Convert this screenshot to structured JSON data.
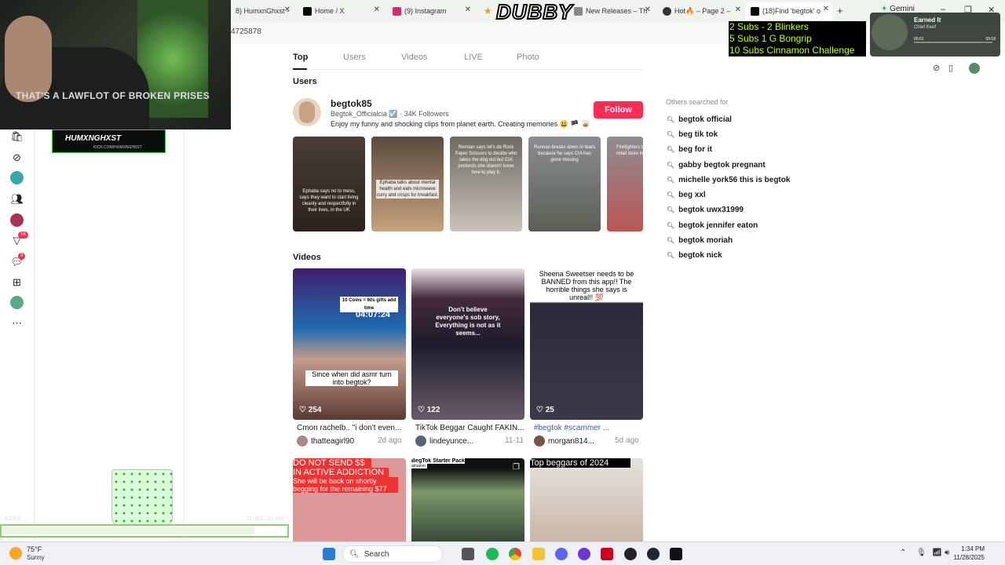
{
  "browser": {
    "tabs": [
      {
        "label": "8) HumxnGhxst -",
        "color": "#53fc18"
      },
      {
        "label": "Home / X",
        "color": "#000000"
      },
      {
        "label": "(9) Instagram",
        "color": "#d62976"
      },
      {
        "label": "New Releases – Th",
        "color": "#888888"
      },
      {
        "label": "Hot🔥 – Page 2 –",
        "color": "#333333"
      },
      {
        "label": "(18)Find 'begtok' o",
        "color": "#000000"
      }
    ],
    "new_tab": "+",
    "gemini": "Gemini",
    "address_fragment": "4725878"
  },
  "overlay": {
    "cam_text": "THAT'S A LAWFLOT OF BROKEN PRISES",
    "kick_name": "HUMXNGHXST",
    "kick_url": "KICK.COM/HUMXNGHXST",
    "dubby": "DUBBY",
    "subs_goals": [
      "2 Subs - 2 Blinkers",
      "5 Subs 1 G Bongrip",
      "10 Subs Cinnamon Challenge"
    ],
    "music_title": "Earned It",
    "music_artist": "Chief Keef",
    "music_elapsed": "00:01",
    "music_total": "09:18",
    "goal_left": "KICKS",
    "goal_right": "11,353 / 20,000"
  },
  "rail": {
    "badges": {
      "activity": "16",
      "messages": "9"
    }
  },
  "search_tabs": [
    "Top",
    "Users",
    "Videos",
    "LIVE",
    "Photo"
  ],
  "users_section": {
    "heading": "Users",
    "username": "begtok85",
    "handle": "Begtok_Officialcia ☑️ · 34K Followers",
    "bio": "Enjoy my funny and shocking clips from planet earth. Creating memories 😃 🏴 🥃",
    "follow_label": "Follow",
    "thumbs": [
      "Ephaba says no to mess, says they want to start living cleanly and respectfully in their lives, in the UK",
      "Ephaba talks about mental health and eats microwave curry and crisps for breakfast.",
      "Ronnan says let's do Rock Paper Scissors to decide who takes the dog out but CIA pretends she doesn't know how to play it.",
      "Ronnan breaks down in tears because he says CIA has gone missing",
      "Firefighters tackle a huge retail store in London, UK"
    ]
  },
  "videos_section": {
    "heading": "Videos",
    "items": [
      {
        "overlay": "Since when did asmr turn into begtok?",
        "likes": "254",
        "title": "Cmon rachelb.. \"i don't even...",
        "user": "thatteagirl90",
        "date": "2d ago",
        "timer": "04:07:24",
        "coins": "10 Coins = 60s gifts add time"
      },
      {
        "overlay": "Don't believe everyone's sob story, Everything is not as it seems...",
        "likes": "122",
        "title": "TikTok Beggar Caught FAKIN...",
        "user": "lindeyunce...",
        "date": "11-11"
      },
      {
        "overlay": "Sheena Sweetser needs to be BANNED from this app!! The horrible things she says is unreal!! 💯",
        "likes": "25",
        "title": "#begtok #scammer ...",
        "user": "morgan814...",
        "date": "5d ago"
      }
    ],
    "row2": [
      {
        "line1": "DO NOT SEND $$",
        "line2": "IN ACTIVE ADDICTION",
        "line3": "She will be back on shortly begging for the remaining $77"
      },
      {
        "line1": "BegTok Starter Pack",
        "tag": "amazon"
      },
      {
        "line1": "Top beggars of 2024"
      }
    ]
  },
  "others_searched": {
    "heading": "Others searched for",
    "items": [
      "begtok official",
      "beg tik tok",
      "beg for it",
      "gabby begtok pregnant",
      "michelle york56 this is begtok",
      "beg xxl",
      "begtok uwx31999",
      "begtok jennifer eaton",
      "begtok moriah",
      "begtok nick"
    ]
  },
  "taskbar": {
    "weather_temp": "75°F",
    "weather_desc": "Sunny",
    "search_placeholder": "Search",
    "time": "1:34 PM",
    "date": "11/28/2025"
  }
}
